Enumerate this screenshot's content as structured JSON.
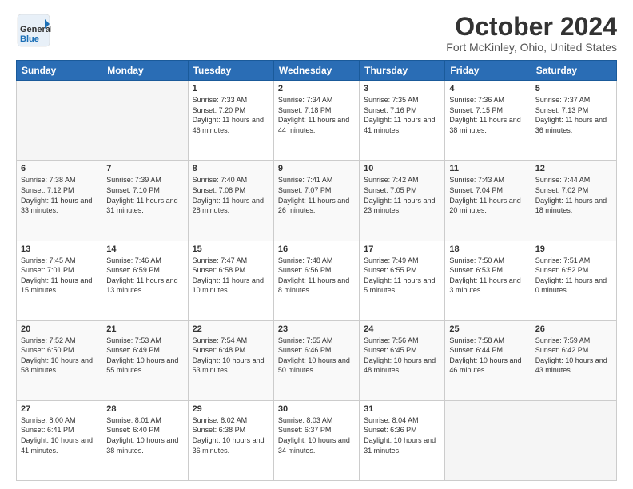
{
  "header": {
    "logo_general": "General",
    "logo_blue": "Blue",
    "month_title": "October 2024",
    "location": "Fort McKinley, Ohio, United States"
  },
  "days_of_week": [
    "Sunday",
    "Monday",
    "Tuesday",
    "Wednesday",
    "Thursday",
    "Friday",
    "Saturday"
  ],
  "weeks": [
    [
      {
        "day": "",
        "empty": true
      },
      {
        "day": "",
        "empty": true
      },
      {
        "day": "1",
        "sunrise": "Sunrise: 7:33 AM",
        "sunset": "Sunset: 7:20 PM",
        "daylight": "Daylight: 11 hours and 46 minutes."
      },
      {
        "day": "2",
        "sunrise": "Sunrise: 7:34 AM",
        "sunset": "Sunset: 7:18 PM",
        "daylight": "Daylight: 11 hours and 44 minutes."
      },
      {
        "day": "3",
        "sunrise": "Sunrise: 7:35 AM",
        "sunset": "Sunset: 7:16 PM",
        "daylight": "Daylight: 11 hours and 41 minutes."
      },
      {
        "day": "4",
        "sunrise": "Sunrise: 7:36 AM",
        "sunset": "Sunset: 7:15 PM",
        "daylight": "Daylight: 11 hours and 38 minutes."
      },
      {
        "day": "5",
        "sunrise": "Sunrise: 7:37 AM",
        "sunset": "Sunset: 7:13 PM",
        "daylight": "Daylight: 11 hours and 36 minutes."
      }
    ],
    [
      {
        "day": "6",
        "sunrise": "Sunrise: 7:38 AM",
        "sunset": "Sunset: 7:12 PM",
        "daylight": "Daylight: 11 hours and 33 minutes."
      },
      {
        "day": "7",
        "sunrise": "Sunrise: 7:39 AM",
        "sunset": "Sunset: 7:10 PM",
        "daylight": "Daylight: 11 hours and 31 minutes."
      },
      {
        "day": "8",
        "sunrise": "Sunrise: 7:40 AM",
        "sunset": "Sunset: 7:08 PM",
        "daylight": "Daylight: 11 hours and 28 minutes."
      },
      {
        "day": "9",
        "sunrise": "Sunrise: 7:41 AM",
        "sunset": "Sunset: 7:07 PM",
        "daylight": "Daylight: 11 hours and 26 minutes."
      },
      {
        "day": "10",
        "sunrise": "Sunrise: 7:42 AM",
        "sunset": "Sunset: 7:05 PM",
        "daylight": "Daylight: 11 hours and 23 minutes."
      },
      {
        "day": "11",
        "sunrise": "Sunrise: 7:43 AM",
        "sunset": "Sunset: 7:04 PM",
        "daylight": "Daylight: 11 hours and 20 minutes."
      },
      {
        "day": "12",
        "sunrise": "Sunrise: 7:44 AM",
        "sunset": "Sunset: 7:02 PM",
        "daylight": "Daylight: 11 hours and 18 minutes."
      }
    ],
    [
      {
        "day": "13",
        "sunrise": "Sunrise: 7:45 AM",
        "sunset": "Sunset: 7:01 PM",
        "daylight": "Daylight: 11 hours and 15 minutes."
      },
      {
        "day": "14",
        "sunrise": "Sunrise: 7:46 AM",
        "sunset": "Sunset: 6:59 PM",
        "daylight": "Daylight: 11 hours and 13 minutes."
      },
      {
        "day": "15",
        "sunrise": "Sunrise: 7:47 AM",
        "sunset": "Sunset: 6:58 PM",
        "daylight": "Daylight: 11 hours and 10 minutes."
      },
      {
        "day": "16",
        "sunrise": "Sunrise: 7:48 AM",
        "sunset": "Sunset: 6:56 PM",
        "daylight": "Daylight: 11 hours and 8 minutes."
      },
      {
        "day": "17",
        "sunrise": "Sunrise: 7:49 AM",
        "sunset": "Sunset: 6:55 PM",
        "daylight": "Daylight: 11 hours and 5 minutes."
      },
      {
        "day": "18",
        "sunrise": "Sunrise: 7:50 AM",
        "sunset": "Sunset: 6:53 PM",
        "daylight": "Daylight: 11 hours and 3 minutes."
      },
      {
        "day": "19",
        "sunrise": "Sunrise: 7:51 AM",
        "sunset": "Sunset: 6:52 PM",
        "daylight": "Daylight: 11 hours and 0 minutes."
      }
    ],
    [
      {
        "day": "20",
        "sunrise": "Sunrise: 7:52 AM",
        "sunset": "Sunset: 6:50 PM",
        "daylight": "Daylight: 10 hours and 58 minutes."
      },
      {
        "day": "21",
        "sunrise": "Sunrise: 7:53 AM",
        "sunset": "Sunset: 6:49 PM",
        "daylight": "Daylight: 10 hours and 55 minutes."
      },
      {
        "day": "22",
        "sunrise": "Sunrise: 7:54 AM",
        "sunset": "Sunset: 6:48 PM",
        "daylight": "Daylight: 10 hours and 53 minutes."
      },
      {
        "day": "23",
        "sunrise": "Sunrise: 7:55 AM",
        "sunset": "Sunset: 6:46 PM",
        "daylight": "Daylight: 10 hours and 50 minutes."
      },
      {
        "day": "24",
        "sunrise": "Sunrise: 7:56 AM",
        "sunset": "Sunset: 6:45 PM",
        "daylight": "Daylight: 10 hours and 48 minutes."
      },
      {
        "day": "25",
        "sunrise": "Sunrise: 7:58 AM",
        "sunset": "Sunset: 6:44 PM",
        "daylight": "Daylight: 10 hours and 46 minutes."
      },
      {
        "day": "26",
        "sunrise": "Sunrise: 7:59 AM",
        "sunset": "Sunset: 6:42 PM",
        "daylight": "Daylight: 10 hours and 43 minutes."
      }
    ],
    [
      {
        "day": "27",
        "sunrise": "Sunrise: 8:00 AM",
        "sunset": "Sunset: 6:41 PM",
        "daylight": "Daylight: 10 hours and 41 minutes."
      },
      {
        "day": "28",
        "sunrise": "Sunrise: 8:01 AM",
        "sunset": "Sunset: 6:40 PM",
        "daylight": "Daylight: 10 hours and 38 minutes."
      },
      {
        "day": "29",
        "sunrise": "Sunrise: 8:02 AM",
        "sunset": "Sunset: 6:38 PM",
        "daylight": "Daylight: 10 hours and 36 minutes."
      },
      {
        "day": "30",
        "sunrise": "Sunrise: 8:03 AM",
        "sunset": "Sunset: 6:37 PM",
        "daylight": "Daylight: 10 hours and 34 minutes."
      },
      {
        "day": "31",
        "sunrise": "Sunrise: 8:04 AM",
        "sunset": "Sunset: 6:36 PM",
        "daylight": "Daylight: 10 hours and 31 minutes."
      },
      {
        "day": "",
        "empty": true
      },
      {
        "day": "",
        "empty": true
      }
    ]
  ]
}
